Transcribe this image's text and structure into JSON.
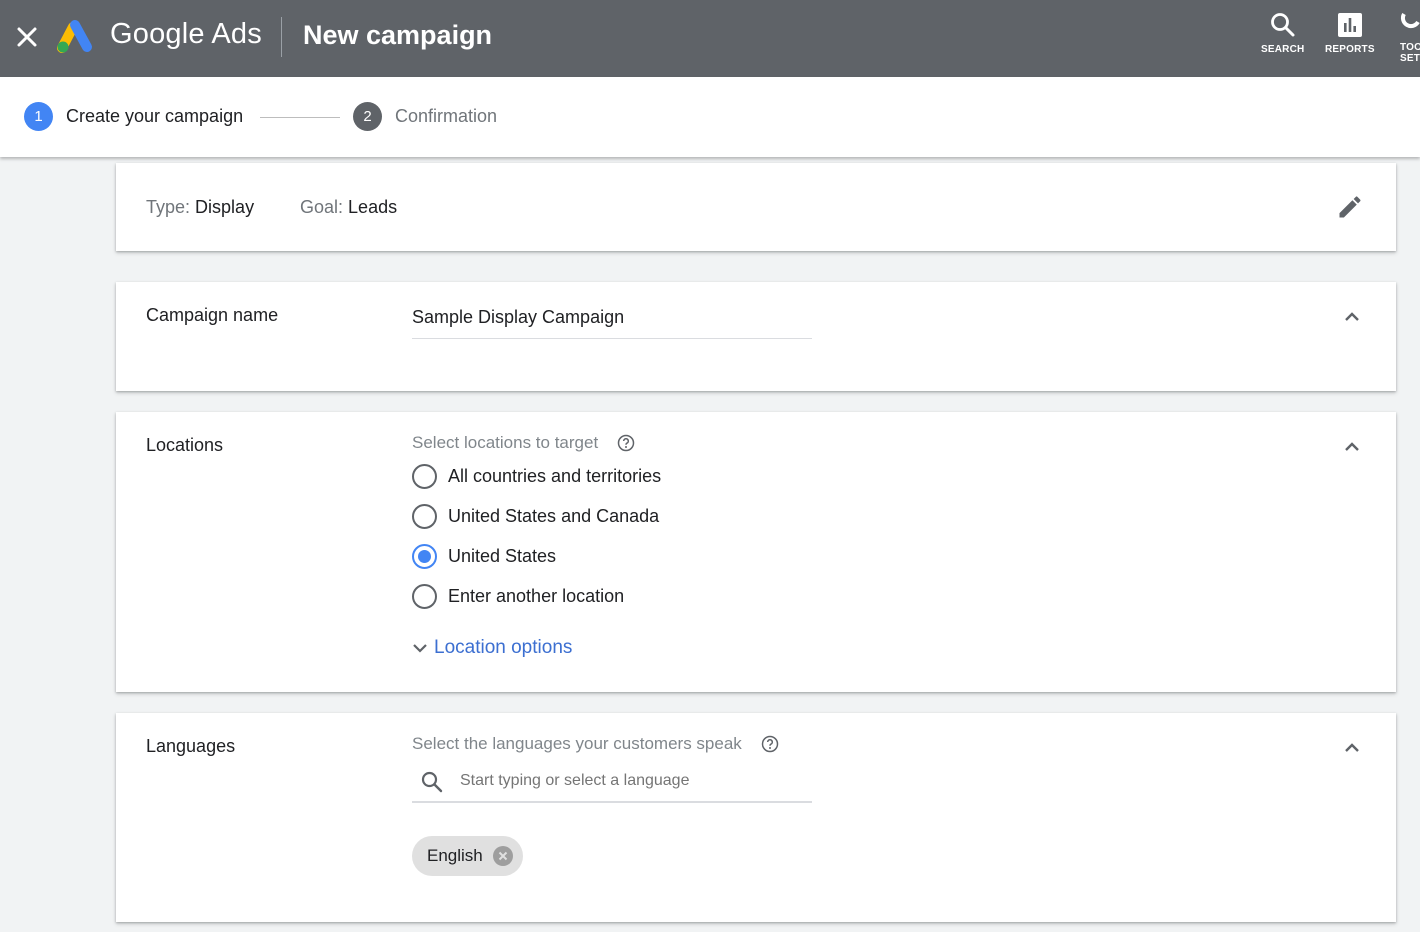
{
  "appbar": {
    "brand": "Google Ads",
    "title": "New campaign",
    "actions": [
      {
        "icon": "search-icon",
        "label": "SEARCH"
      },
      {
        "icon": "reports-icon",
        "label": "REPORTS"
      },
      {
        "icon": "tools-icon",
        "label_line1": "TOO",
        "label_line2": "SET"
      }
    ],
    "colors": {
      "background": "#5f6368",
      "logo_blue": "#4285f4",
      "logo_yellow": "#fbbc04",
      "logo_green": "#34a853"
    }
  },
  "stepper": {
    "steps": [
      {
        "number": "1",
        "label": "Create your campaign",
        "active": true
      },
      {
        "number": "2",
        "label": "Confirmation",
        "active": false
      }
    ],
    "colors": {
      "active": "#4285f4",
      "inactive": "#5f6368"
    }
  },
  "summary": {
    "type_key": "Type:",
    "type_value": "Display",
    "goal_key": "Goal:",
    "goal_value": "Leads"
  },
  "campaign_name": {
    "label": "Campaign name",
    "value": "Sample Display Campaign"
  },
  "locations": {
    "label": "Locations",
    "hint": "Select locations to target",
    "options": [
      {
        "label": "All countries and territories",
        "checked": false
      },
      {
        "label": "United States and Canada",
        "checked": false
      },
      {
        "label": "United States",
        "checked": true
      },
      {
        "label": "Enter another location",
        "checked": false
      }
    ],
    "options_link": "Location options"
  },
  "languages": {
    "label": "Languages",
    "hint": "Select the languages your customers speak",
    "search_placeholder": "Start typing or select a language",
    "selected": [
      "English"
    ]
  }
}
